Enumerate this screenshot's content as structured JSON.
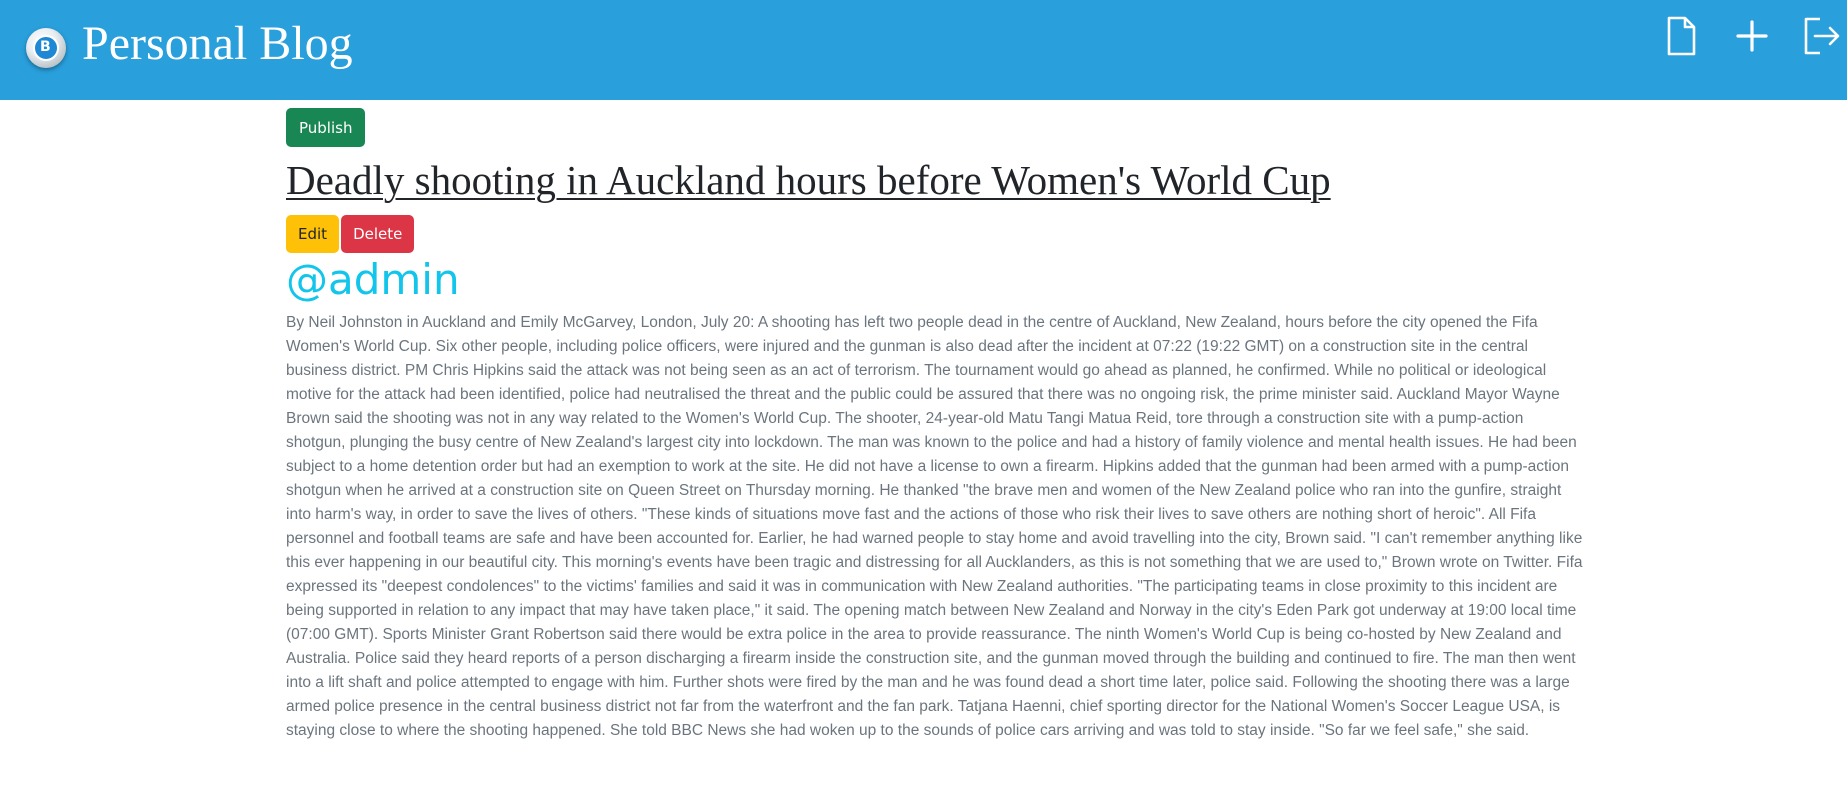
{
  "app": {
    "title": "Personal Blog",
    "logo_letter": "B"
  },
  "header": {
    "icons": [
      "document-icon",
      "plus-icon",
      "logout-icon"
    ]
  },
  "post": {
    "publish_label": "Publish",
    "title": "Deadly shooting in Auckland hours before Women's World Cup",
    "edit_label": "Edit",
    "delete_label": "Delete",
    "author": "@admin",
    "body": "By Neil Johnston in Auckland and Emily McGarvey, London, July 20: A shooting has left two people dead in the centre of Auckland, New Zealand, hours before the city opened the Fifa Women's World Cup. Six other people, including police officers, were injured and the gunman is also dead after the incident at 07:22 (19:22 GMT) on a construction site in the central business district. PM Chris Hipkins said the attack was not being seen as an act of terrorism. The tournament would go ahead as planned, he confirmed. While no political or ideological motive for the attack had been identified, police had neutralised the threat and the public could be assured that there was no ongoing risk, the prime minister said. Auckland Mayor Wayne Brown said the shooting was not in any way related to the Women's World Cup. The shooter, 24-year-old Matu Tangi Matua Reid, tore through a construction site with a pump-action shotgun, plunging the busy centre of New Zealand's largest city into lockdown. The man was known to the police and had a history of family violence and mental health issues. He had been subject to a home detention order but had an exemption to work at the site. He did not have a license to own a firearm. Hipkins added that the gunman had been armed with a pump-action shotgun when he arrived at a construction site on Queen Street on Thursday morning. He thanked \"the brave men and women of the New Zealand police who ran into the gunfire, straight into harm's way, in order to save the lives of others. \"These kinds of situations move fast and the actions of those who risk their lives to save others are nothing short of heroic\". All Fifa personnel and football teams are safe and have been accounted for. Earlier, he had warned people to stay home and avoid travelling into the city, Brown said. \"I can't remember anything like this ever happening in our beautiful city. This morning's events have been tragic and distressing for all Aucklanders, as this is not something that we are used to,\" Brown wrote on Twitter. Fifa expressed its \"deepest condolences\" to the victims' families and said it was in communication with New Zealand authorities. \"The participating teams in close proximity to this incident are being supported in relation to any impact that may have taken place,\" it said. The opening match between New Zealand and Norway in the city's Eden Park got underway at 19:00 local time (07:00 GMT). Sports Minister Grant Robertson said there would be extra police in the area to provide reassurance. The ninth Women's World Cup is being co-hosted by New Zealand and Australia. Police said they heard reports of a person discharging a firearm inside the construction site, and the gunman moved through the building and continued to fire. The man then went into a lift shaft and police attempted to engage with him. Further shots were fired by the man and he was found dead a short time later, police said. Following the shooting there was a large armed police presence in the central business district not far from the waterfront and the fan park. Tatjana Haenni, chief sporting director for the National Women's Soccer League USA, is staying close to where the shooting happened. She told BBC News she had woken up to the sounds of police cars arriving and was told to stay inside. \"So far we feel safe,\" she said."
  },
  "colors": {
    "navbar": "#299fdc",
    "publish": "#198754",
    "edit": "#ffc107",
    "delete": "#dc3545",
    "author": "#13c5ea",
    "body_text": "#6c757d"
  }
}
